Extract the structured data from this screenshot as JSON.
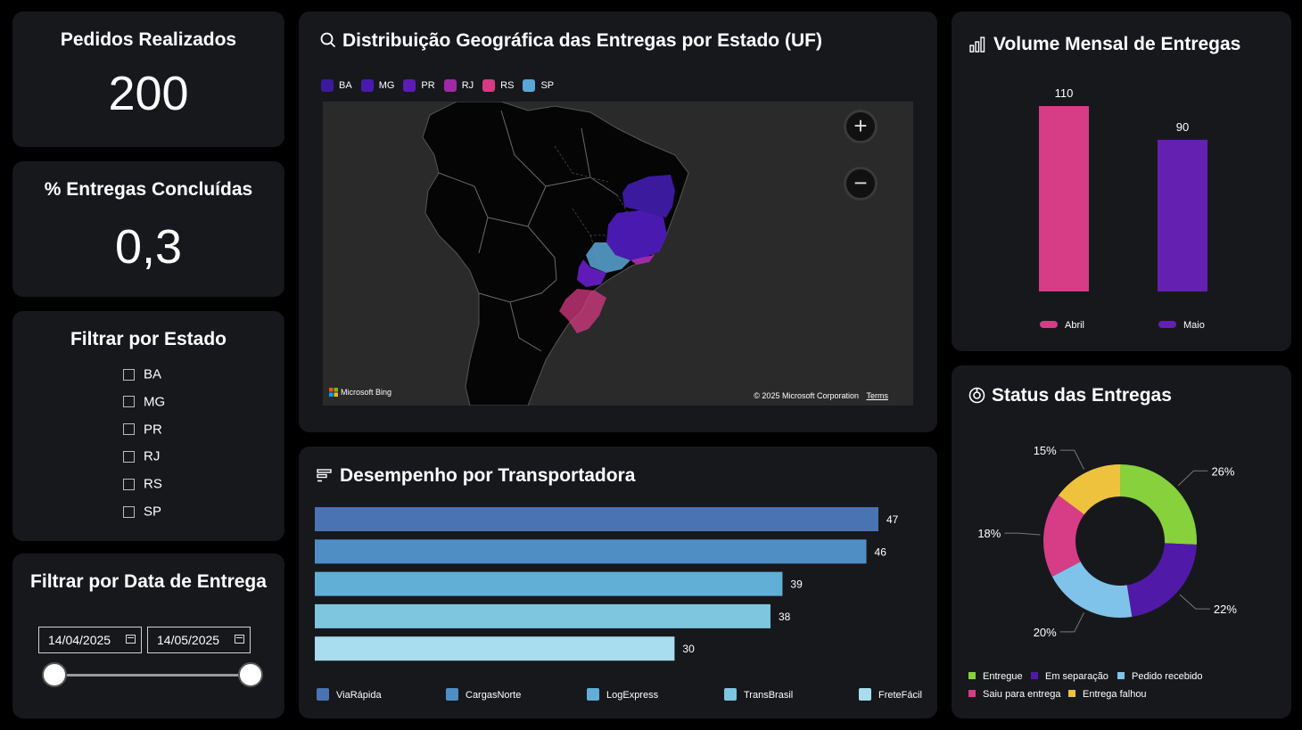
{
  "kpi_orders": {
    "title": "Pedidos Realizados",
    "value": "200"
  },
  "kpi_delivered": {
    "title": "% Entregas Concluídas",
    "value": "0,3"
  },
  "state_filter": {
    "title": "Filtrar por Estado",
    "options": [
      "BA",
      "MG",
      "PR",
      "RJ",
      "RS",
      "SP"
    ]
  },
  "date_filter": {
    "title": "Filtrar por Data de Entrega",
    "start": "14/04/2025",
    "end": "14/05/2025",
    "range_fraction": [
      0,
      1
    ]
  },
  "map_card": {
    "title": "Distribuição Geográfica das Entregas por Estado (UF)",
    "legend": [
      {
        "label": "BA",
        "color": "#3b1a9e"
      },
      {
        "label": "MG",
        "color": "#4a1ab0"
      },
      {
        "label": "PR",
        "color": "#5e1bb5"
      },
      {
        "label": "RJ",
        "color": "#a02aa6"
      },
      {
        "label": "RS",
        "color": "#d63a82"
      },
      {
        "label": "SP",
        "color": "#5aa6d6"
      }
    ],
    "zoom_in": "+",
    "zoom_out": "−",
    "attribution": "Microsoft Bing",
    "copyright": "© 2025 Microsoft Corporation",
    "terms": "Terms"
  },
  "carrier_card": {
    "title": "Desempenho por Transportadora",
    "legend_colors": [
      "#4a73b3",
      "#4f8ec4",
      "#61afd6",
      "#7ec5e0",
      "#a8dcef"
    ]
  },
  "monthly_card": {
    "title": "Volume Mensal de Entregas",
    "colors": [
      "#d63d86",
      "#6420b0"
    ]
  },
  "status_card": {
    "title": "Status das Entregas",
    "colors": [
      "#86d13c",
      "#5119a8",
      "#7fc2ea",
      "#d63d86",
      "#efc23d"
    ]
  },
  "chart_data": [
    {
      "type": "bar",
      "orientation": "horizontal",
      "categories": [
        "ViaRápida",
        "CargasNorte",
        "LogExpress",
        "TransBrasil",
        "FreteFácil"
      ],
      "values": [
        47,
        46,
        39,
        38,
        30
      ],
      "title": "Desempenho por Transportadora"
    },
    {
      "type": "bar",
      "categories": [
        "Abril",
        "Maio"
      ],
      "values": [
        110,
        90
      ],
      "title": "Volume Mensal de Entregas"
    },
    {
      "type": "pie",
      "categories": [
        "Entregue",
        "Em separação",
        "Pedido recebido",
        "Saiu para entrega",
        "Entrega falhou"
      ],
      "values": [
        26,
        22,
        20,
        18,
        15
      ],
      "value_labels": [
        "26%",
        "22%",
        "20%",
        "18%",
        "15%"
      ],
      "title": "Status das Entregas"
    }
  ]
}
